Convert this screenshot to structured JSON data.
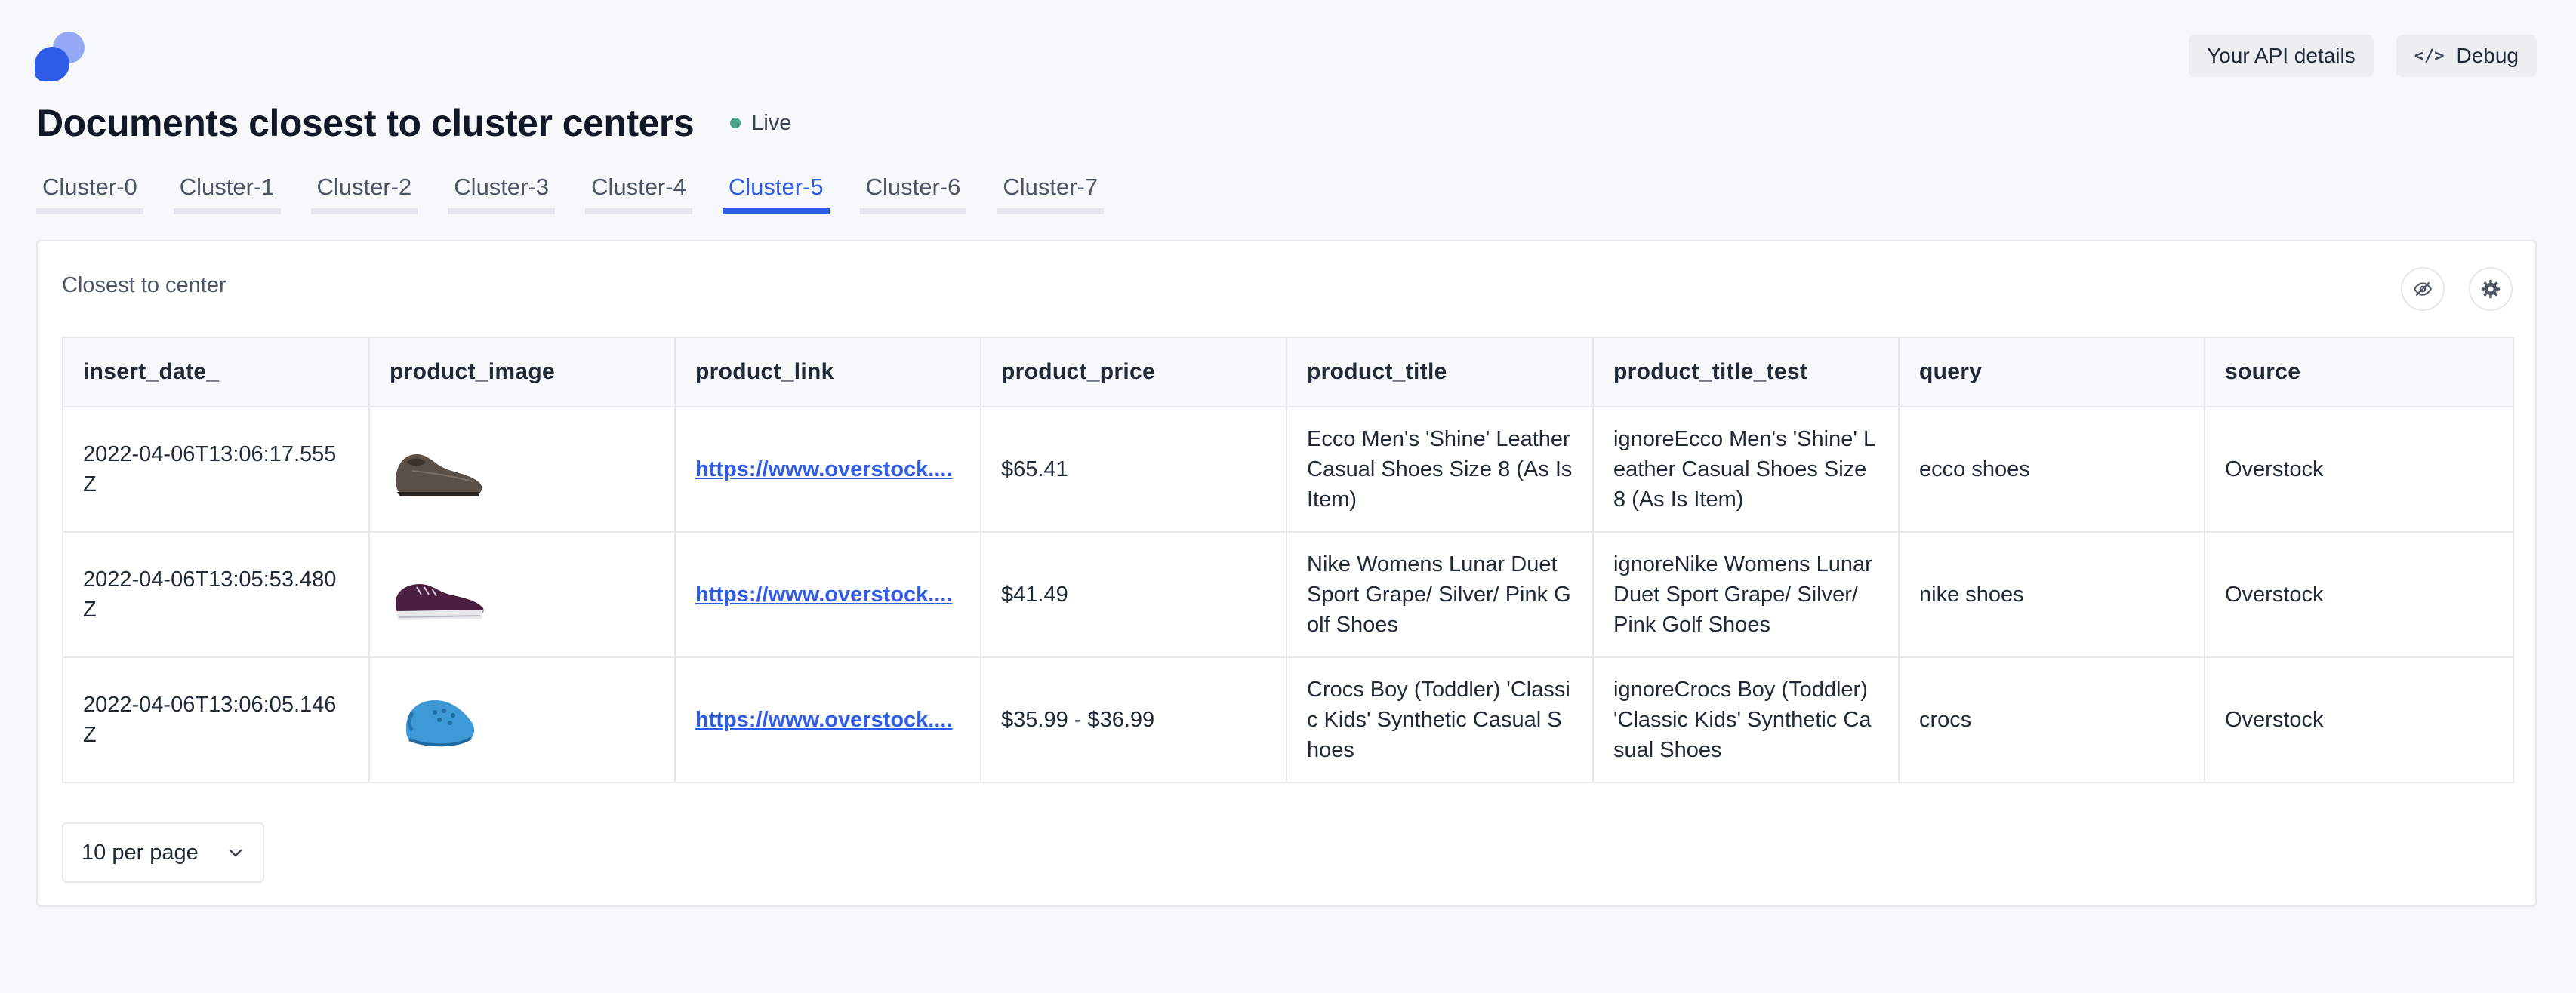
{
  "header": {
    "api_details_label": "Your API details",
    "debug_label": "Debug",
    "title": "Documents closest to cluster centers",
    "status": "Live"
  },
  "tabs": [
    {
      "label": "Cluster-0",
      "active": false
    },
    {
      "label": "Cluster-1",
      "active": false
    },
    {
      "label": "Cluster-2",
      "active": false
    },
    {
      "label": "Cluster-3",
      "active": false
    },
    {
      "label": "Cluster-4",
      "active": false
    },
    {
      "label": "Cluster-5",
      "active": true
    },
    {
      "label": "Cluster-6",
      "active": false
    },
    {
      "label": "Cluster-7",
      "active": false
    }
  ],
  "card": {
    "title": "Closest to center",
    "visibility_icon": "eye-off-icon",
    "settings_icon": "gear-icon"
  },
  "table": {
    "columns": [
      "insert_date_",
      "product_image",
      "product_link",
      "product_price",
      "product_title",
      "product_title_test",
      "query",
      "source"
    ],
    "rows": [
      {
        "insert_date_": "2022-04-06T13:06:17.555Z",
        "product_image": "brown-loafer-shoe-image",
        "product_link": "https://www.overstock....",
        "product_price": "$65.41",
        "product_title": "Ecco Men's 'Shine' Leather Casual Shoes Size 8 (As Is Item)",
        "product_title_test": "ignoreEcco Men's 'Shine' Leather Casual Shoes Size 8 (As Is Item)",
        "query": "ecco shoes",
        "source": "Overstock"
      },
      {
        "insert_date_": "2022-04-06T13:05:53.480Z",
        "product_image": "purple-sneaker-shoe-image",
        "product_link": "https://www.overstock....",
        "product_price": "$41.49",
        "product_title": "Nike Womens Lunar Duet Sport Grape/ Silver/ Pink Golf Shoes",
        "product_title_test": "ignoreNike Womens Lunar Duet Sport Grape/ Silver/ Pink Golf Shoes",
        "query": "nike shoes",
        "source": "Overstock"
      },
      {
        "insert_date_": "2022-04-06T13:06:05.146Z",
        "product_image": "blue-clog-shoe-image",
        "product_link": "https://www.overstock....",
        "product_price": "$35.99 - $36.99",
        "product_title": "Crocs Boy (Toddler) 'Classic Kids' Synthetic Casual Shoes",
        "product_title_test": "ignoreCrocs Boy (Toddler) 'Classic Kids' Synthetic Casual Shoes",
        "query": "crocs",
        "source": "Overstock"
      }
    ]
  },
  "pagination": {
    "per_page_label": "10 per page"
  },
  "colors": {
    "accent": "#2f5ce6",
    "live": "#4fa389",
    "background": "#f7f8fa"
  }
}
